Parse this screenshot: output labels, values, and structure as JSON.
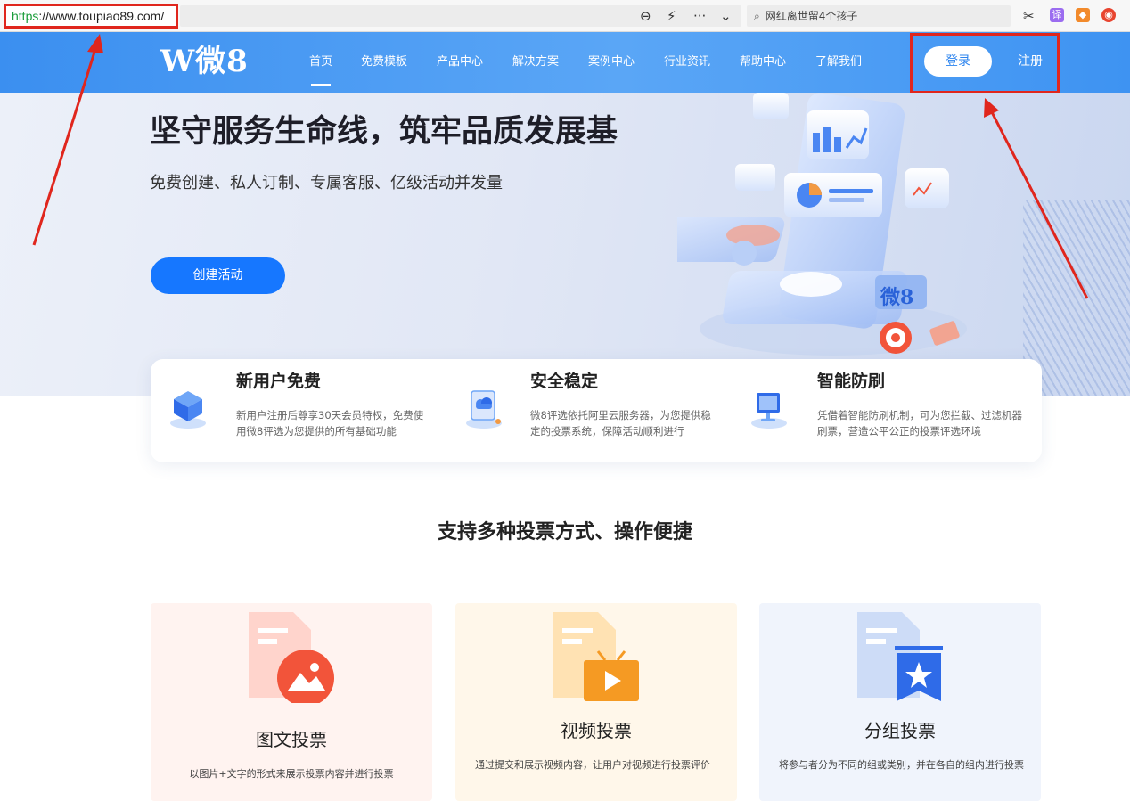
{
  "browser": {
    "url_scheme": "https",
    "url_rest": "://www.toupiao89.com/",
    "search_placeholder": "网红离世留4个孩子",
    "more_label": "···",
    "ext_translate": "译"
  },
  "nav": {
    "logo": "W微8",
    "items": [
      "首页",
      "免费模板",
      "产品中心",
      "解决方案",
      "案例中心",
      "行业资讯",
      "帮助中心",
      "了解我们"
    ],
    "login": "登录",
    "register": "注册"
  },
  "hero": {
    "title": "坚守服务生命线，筑牢品质发展基",
    "subtitle": "免费创建、私人订制、专属客服、亿级活动并发量",
    "cta": "创建活动",
    "illustration_badge": "微8"
  },
  "features": [
    {
      "title": "新用户免费",
      "desc": "新用户注册后尊享30天会员特权，免费使用微8评选为您提供的所有基础功能"
    },
    {
      "title": "安全稳定",
      "desc": "微8评选依托阿里云服务器，为您提供稳定的投票系统，保障活动顺利进行"
    },
    {
      "title": "智能防刷",
      "desc": "凭借着智能防刷机制，可为您拦截、过滤机器刷票，营造公平公正的投票评选环境"
    }
  ],
  "section": {
    "title": "支持多种投票方式、操作便捷"
  },
  "vote_types": [
    {
      "title": "图文投票",
      "desc": "以图片+文字的形式来展示投票内容并进行投票",
      "bg": "#fff3f0",
      "accent": "#f2543a"
    },
    {
      "title": "视频投票",
      "desc": "通过提交和展示视频内容，让用户对视频进行投票评价",
      "bg": "#fff7ea",
      "accent": "#f59a23"
    },
    {
      "title": "分组投票",
      "desc": "将参与者分为不同的组或类别，并在各自的组内进行投票",
      "bg": "#f0f4fc",
      "accent": "#2f6be8"
    }
  ],
  "colors": {
    "brand": "#1677ff",
    "nav": "#4a9bf4",
    "annotation": "#e0261d"
  }
}
